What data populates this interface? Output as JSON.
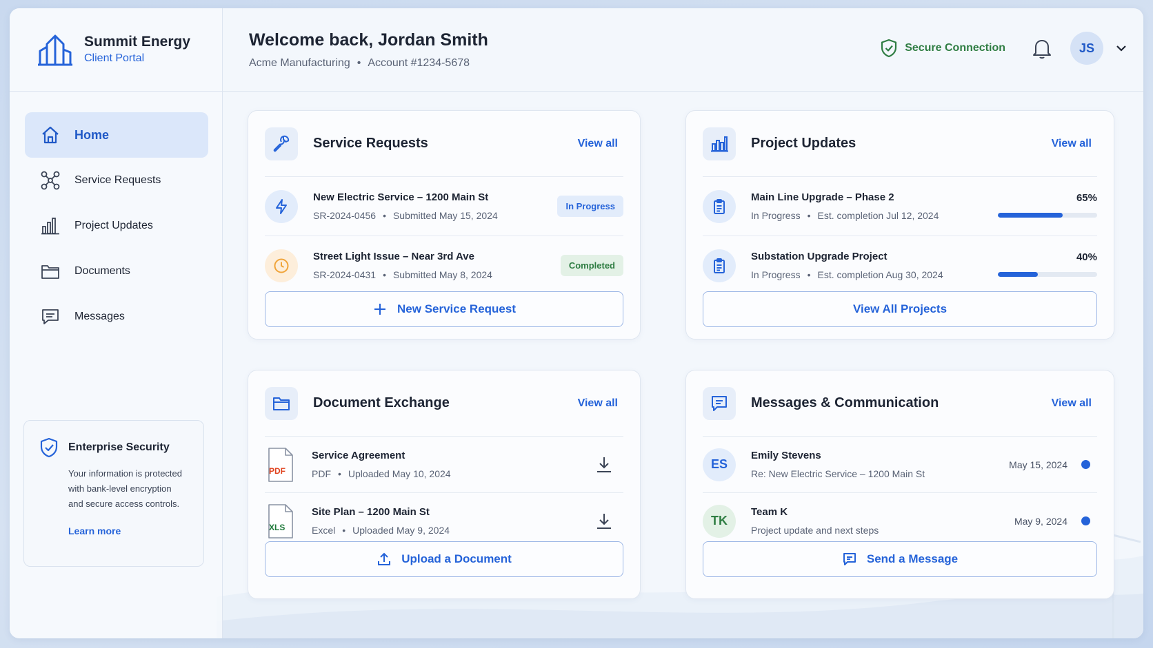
{
  "brand": {
    "name": "Summit Energy",
    "subtitle": "Client Portal"
  },
  "header": {
    "welcome": "Welcome back, Jordan Smith",
    "company": "Acme Manufacturing",
    "account": "Account #1234-5678",
    "secure_label": "Secure Connection",
    "avatar_initials": "JS"
  },
  "sidebar": {
    "items": [
      {
        "label": "Home",
        "icon": "home-icon",
        "active": true
      },
      {
        "label": "Service Requests",
        "icon": "network-icon"
      },
      {
        "label": "Project Updates",
        "icon": "bar-chart-icon"
      },
      {
        "label": "Documents",
        "icon": "folder-icon"
      },
      {
        "label": "Messages",
        "icon": "message-icon"
      }
    ],
    "security": {
      "title": "Enterprise Security",
      "body": "Your information is protected with bank-level encryption and secure access controls.",
      "link": "Learn more"
    }
  },
  "service_requests": {
    "title": "Service Requests",
    "view_all": "View all",
    "items": [
      {
        "title": "New Electric Service – 1200 Main St",
        "id": "SR-2024-0456",
        "submitted": "Submitted May 15, 2024",
        "status": "In Progress"
      },
      {
        "title": "Street Light Issue – Near 3rd Ave",
        "id": "SR-2024-0431",
        "submitted": "Submitted May 8, 2024",
        "status": "Completed"
      }
    ],
    "button": "New Service Request"
  },
  "project_updates": {
    "title": "Project Updates",
    "view_all": "View all",
    "items": [
      {
        "title": "Main Line Upgrade – Phase 2",
        "status": "In Progress",
        "completion": "Est. completion Jul 12, 2024",
        "percent_label": "65%",
        "progress": 0.65
      },
      {
        "title": "Substation Upgrade Project",
        "status": "In Progress",
        "completion": "Est. completion Aug 30, 2024",
        "percent_label": "40%",
        "progress": 0.4
      }
    ],
    "button": "View All Projects"
  },
  "documents": {
    "title": "Document Exchange",
    "view_all": "View all",
    "items": [
      {
        "title": "Service Agreement",
        "type": "PDF",
        "uploaded": "Uploaded May 10, 2024",
        "tag": "PDF",
        "tag_color": "#e0421d"
      },
      {
        "title": "Site Plan – 1200 Main St",
        "type": "Excel",
        "uploaded": "Uploaded May 9, 2024",
        "tag": "XLS",
        "tag_color": "#1f7a3a"
      }
    ],
    "button": "Upload a Document"
  },
  "messages": {
    "title": "Messages & Communication",
    "view_all": "View all",
    "items": [
      {
        "initials": "ES",
        "name": "Emily Stevens",
        "subject": "Re: New Electric Service – 1200 Main St",
        "date": "May 15, 2024"
      },
      {
        "initials": "TK",
        "name": "Team K",
        "subject": "Project update and next steps",
        "date": "May 9, 2024"
      }
    ],
    "button": "Send a Message"
  },
  "colors": {
    "accent": "#2563d9",
    "success": "#2f7d43",
    "warning": "#f0a43a"
  }
}
